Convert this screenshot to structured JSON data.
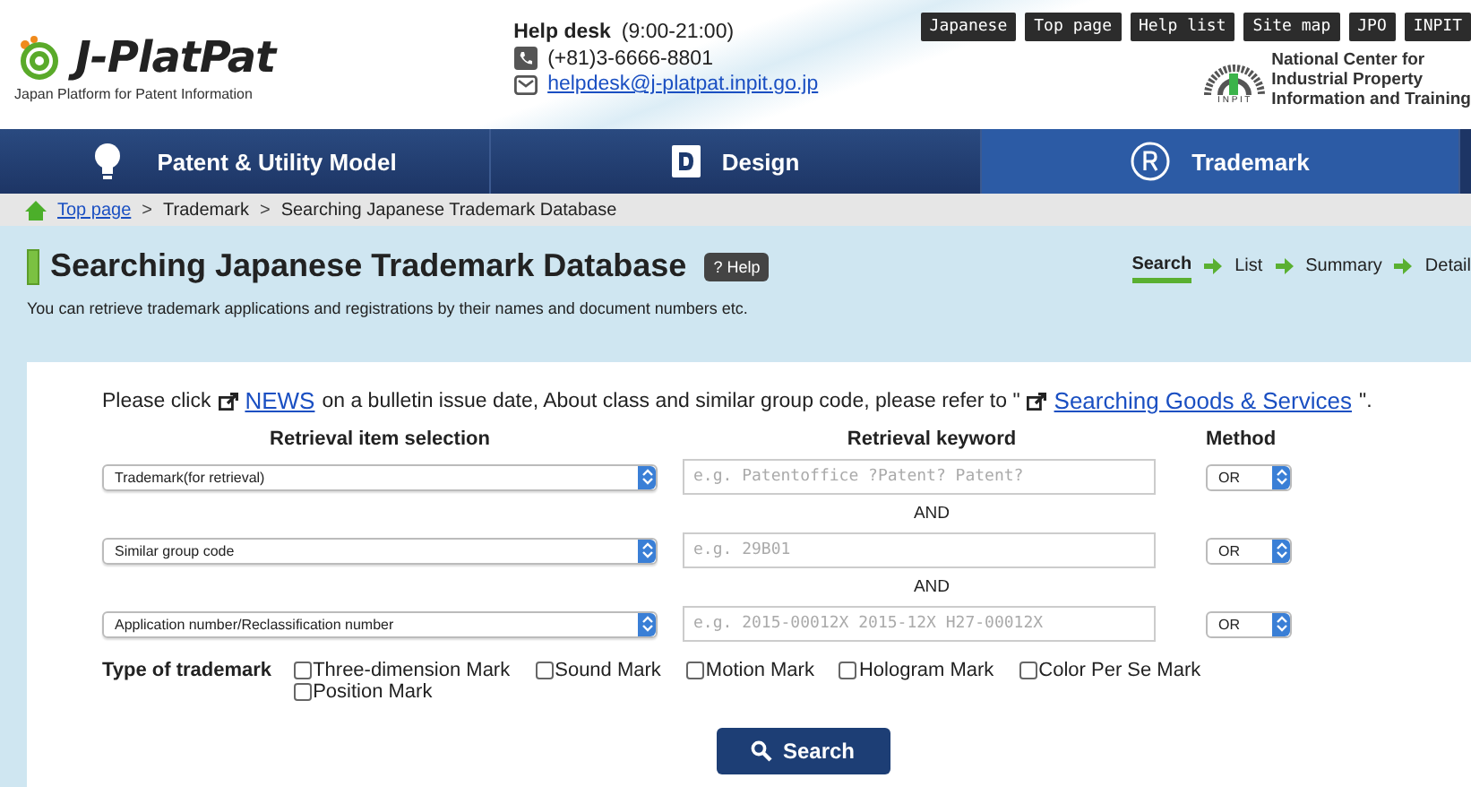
{
  "header": {
    "logo_text": "J-PlatPat",
    "logo_subtitle": "Japan Platform for Patent Information",
    "helpdesk_label": "Help desk",
    "helpdesk_hours": "(9:00-21:00)",
    "phone": "(+81)3-6666-8801",
    "email": "helpdesk@j-platpat.inpit.go.jp",
    "top_links": [
      "Japanese",
      "Top page",
      "Help list",
      "Site map",
      "JPO",
      "INPIT"
    ],
    "org_mark": "I N P I T",
    "org_name": [
      "National Center for",
      "Industrial Property",
      "Information and Training"
    ]
  },
  "nav_tabs": [
    {
      "label": "Patent & Utility Model",
      "selected": false
    },
    {
      "label": "Design",
      "selected": false
    },
    {
      "label": "Trademark",
      "selected": true
    }
  ],
  "breadcrumb": [
    {
      "label": "Top page",
      "link": true
    },
    {
      "separator": ">",
      "label": "Trademark",
      "link": false
    },
    {
      "separator": ">",
      "label": "Searching Japanese Trademark Database",
      "link": false
    }
  ],
  "page": {
    "title": "Searching Japanese Trademark Database",
    "help": "? Help",
    "subtitle": "You can retrieve trademark applications and registrations by their names and document numbers etc.",
    "steps": [
      {
        "label": "Search",
        "selected": true
      },
      {
        "label": "List",
        "selected": false
      },
      {
        "label": "Summary",
        "selected": false
      },
      {
        "label": "Detail",
        "selected": false
      }
    ]
  },
  "notice": {
    "before": "Please click",
    "link1": "NEWS",
    "middle": "on a bulletin issue date, About class and similar group code, please refer to \"",
    "link2": "Searching Goods & Services",
    "after": "\"."
  },
  "columns": [
    "Retrieval item selection",
    "Retrieval keyword",
    "Method"
  ],
  "rows": [
    {
      "connector": null,
      "item": "Trademark(for retrieval)",
      "placeholder": "e.g. Patentoffice ?Patent? Patent?",
      "method": "OR"
    },
    {
      "connector": "AND",
      "item": "Similar group code",
      "placeholder": "e.g. 29B01",
      "method": "OR"
    },
    {
      "connector": "AND",
      "item": "Application number/Reclassification number",
      "placeholder": "e.g. 2015-00012X 2015-12X H27-00012X",
      "method": "OR"
    }
  ],
  "trademark_type": {
    "label": "Type of trademark",
    "options": [
      {
        "label": "Three-dimension Mark",
        "checked": false
      },
      {
        "label": "Sound Mark",
        "checked": false
      },
      {
        "label": "Motion Mark",
        "checked": false
      },
      {
        "label": "Hologram Mark",
        "checked": false
      },
      {
        "label": "Color Per Se Mark",
        "checked": false
      },
      {
        "label": "Position Mark",
        "checked": false
      }
    ]
  },
  "search_button": "Search"
}
